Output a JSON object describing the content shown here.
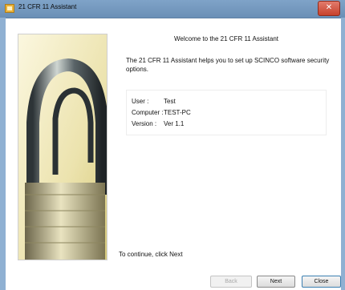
{
  "window": {
    "title": "21 CFR 11 Assistant",
    "close_glyph": "✕",
    "icon": "app-icon"
  },
  "content": {
    "welcome": "Welcome to the 21 CFR 11 Assistant",
    "intro": "The 21 CFR 11 Assistant helps you to set up SCINCO software security options.",
    "info": {
      "user_label": "User :",
      "user_value": "Test",
      "computer_label": "Computer :",
      "computer_value": "TEST-PC",
      "version_label": "Version :",
      "version_value": "Ver 1.1"
    },
    "continue_text": "To continue, click Next"
  },
  "buttons": {
    "back": "Back",
    "next": "Next",
    "close": "Close"
  },
  "image": {
    "subject": "padlock-image"
  }
}
